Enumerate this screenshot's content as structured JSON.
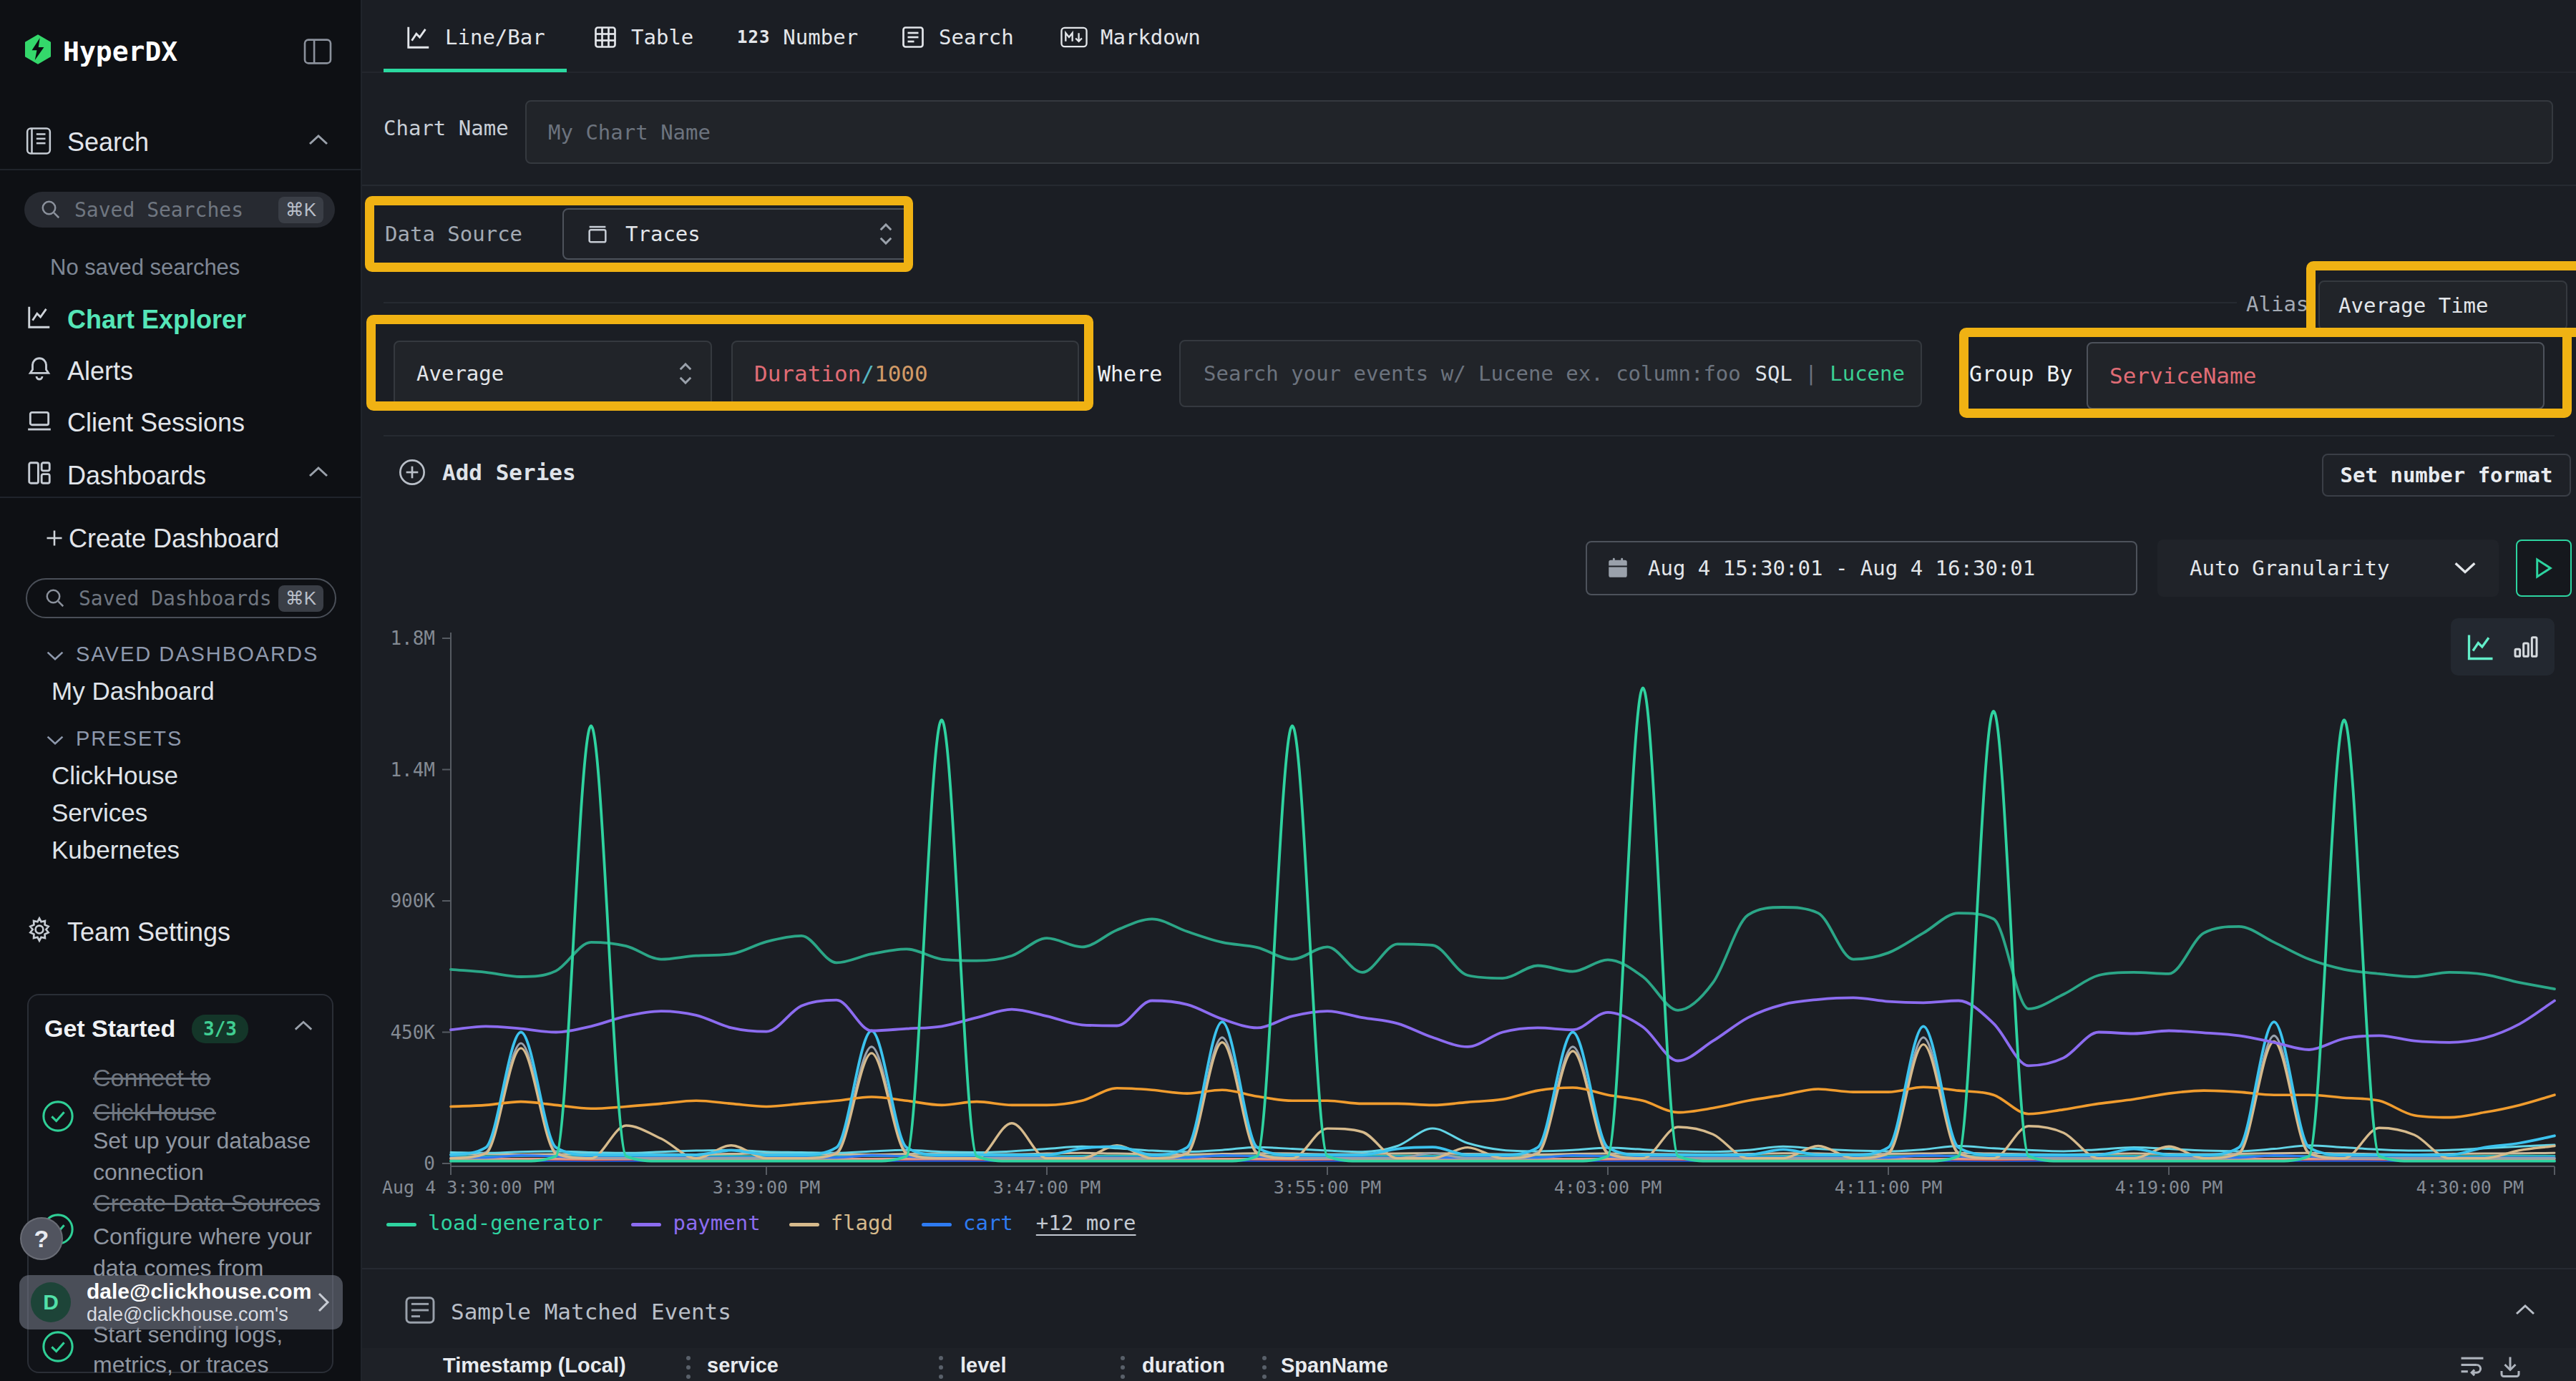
{
  "app": {
    "name": "HyperDX"
  },
  "colors": {
    "sidebar_bg": "#0e1014",
    "main_bg": "#1b1e24",
    "accent_green": "#3fe0ad",
    "annotation_yellow": "#f0b213",
    "input_bg": "#212429",
    "border": "#34383f",
    "border_bright": "#4d525b",
    "text": "#e3e6ea",
    "muted": "#9aa1ab",
    "token_red": "#e06c75",
    "token_cyan": "#56b6c2",
    "token_orange": "#d19a66"
  },
  "sidebar": {
    "logo": "HyperDX",
    "sections": {
      "search": {
        "label": "Search"
      },
      "dashboards": {
        "label": "Dashboards"
      }
    },
    "search_input": {
      "placeholder": "Saved Searches",
      "shortcut": "⌘K"
    },
    "no_saved_searches": "No saved searches",
    "nav": [
      {
        "label": "Chart Explorer",
        "active": true
      },
      {
        "label": "Alerts",
        "active": false
      },
      {
        "label": "Client Sessions",
        "active": false
      }
    ],
    "create_dashboard": "Create Dashboard",
    "dashboards_input": {
      "placeholder": "Saved Dashboards",
      "shortcut": "⌘K"
    },
    "saved_dashboards_label": "SAVED DASHBOARDS",
    "my_dashboard": "My Dashboard",
    "presets_label": "PRESETS",
    "presets": [
      "ClickHouse",
      "Services",
      "Kubernetes"
    ],
    "team_settings": "Team Settings",
    "get_started": {
      "title": "Get Started",
      "badge": "3/3",
      "items": [
        {
          "title_line1": "Connect to",
          "title_line2": "ClickHouse",
          "sub_line1": "Set up your database",
          "sub_line2": "connection",
          "done": true
        },
        {
          "title_line1": "Create Data Sources",
          "title_line2": "",
          "sub_line1": "Configure where your",
          "sub_line2": "data comes from",
          "done": true
        },
        {
          "title_line1": "",
          "title_line2": "",
          "sub_line1": "Start sending logs,",
          "sub_line2": "metrics, or traces",
          "done": true
        }
      ]
    },
    "user": {
      "initial": "D",
      "name": "dale@clickhouse.com",
      "subtext": "dale@clickhouse.com's"
    },
    "help_button": "?"
  },
  "tabs": [
    {
      "label": "Line/Bar",
      "icon": "line-chart",
      "active": true
    },
    {
      "label": "Table",
      "icon": "table",
      "active": false
    },
    {
      "label": "Number",
      "icon": "123",
      "active": false
    },
    {
      "label": "Search",
      "icon": "doc-list",
      "active": false
    },
    {
      "label": "Markdown",
      "icon": "markdown",
      "active": false
    }
  ],
  "chart_form": {
    "chart_name_label": "Chart Name",
    "chart_name_placeholder": "My Chart Name",
    "data_source_label": "Data Source",
    "data_source_value": "Traces",
    "alias_label": "Alias",
    "alias_value": "Average Time",
    "aggregation_value": "Average",
    "field_tokens": {
      "field": "Duration",
      "slash": "/",
      "denominator": "1000"
    },
    "where_label": "Where",
    "where_placeholder": "Search your events w/ Lucene ex. column:foo",
    "language_toggle": {
      "sql": "SQL",
      "divider": "|",
      "lucene": "Lucene"
    },
    "group_by_label": "Group By",
    "group_by_value": "ServiceName",
    "add_series": "Add Series",
    "set_number_format": "Set number format"
  },
  "chart_controls": {
    "date_range": "Aug 4 15:30:01 - Aug 4 16:30:01",
    "granularity": "Auto Granularity"
  },
  "sample_events": {
    "title": "Sample Matched Events",
    "columns": [
      "Timestamp (Local)",
      "service",
      "level",
      "duration",
      "SpanName"
    ]
  },
  "chart_data": {
    "type": "line",
    "title": "",
    "xlabel": "",
    "ylabel": "",
    "x_unit": "minutes after 3:30:00 PM, Aug 4",
    "x_range_minutes": 60,
    "y_unit": "thousands",
    "ylim": [
      0,
      1800
    ],
    "grid": false,
    "legend_position": "bottom-left",
    "x_ticks": [
      {
        "t": 0,
        "label": "Aug 4 3:30:00 PM",
        "align": "left"
      },
      {
        "t": 9,
        "label": "3:39:00 PM",
        "align": "center"
      },
      {
        "t": 17,
        "label": "3:47:00 PM",
        "align": "center"
      },
      {
        "t": 25,
        "label": "3:55:00 PM",
        "align": "center"
      },
      {
        "t": 33,
        "label": "4:03:00 PM",
        "align": "center"
      },
      {
        "t": 41,
        "label": "4:11:00 PM",
        "align": "center"
      },
      {
        "t": 49,
        "label": "4:19:00 PM",
        "align": "center"
      },
      {
        "t": 60,
        "label": "4:30:00 PM",
        "align": "right"
      }
    ],
    "y_ticks": [
      {
        "v": 0,
        "label": "0"
      },
      {
        "v": 450,
        "label": "450K"
      },
      {
        "v": 900,
        "label": "900K"
      },
      {
        "v": 1350,
        "label": "1.4M"
      },
      {
        "v": 1800,
        "label": "1.8M"
      }
    ],
    "legend": {
      "items": [
        {
          "label": "load-generator",
          "series": "load-generator"
        },
        {
          "label": "payment",
          "series": "payment"
        },
        {
          "label": "flagd",
          "series": "flagd"
        },
        {
          "label": "cart",
          "series": "cart"
        }
      ],
      "more_label": "+12 more"
    },
    "series": [
      {
        "name": "unnamed-blue",
        "color": "#2456d9",
        "width": 3.0,
        "values": [
          9,
          9,
          9,
          9,
          9,
          9,
          9,
          9,
          9,
          9,
          9,
          9,
          9,
          9,
          9,
          9,
          9,
          9,
          9,
          9,
          9,
          9,
          9,
          9,
          9,
          9,
          9,
          9,
          9,
          9,
          9,
          9,
          9,
          9,
          9,
          9,
          9,
          9,
          9,
          9,
          9,
          9,
          9,
          9,
          9,
          9,
          9,
          9,
          9,
          9,
          9,
          9,
          9,
          9,
          9,
          9,
          9,
          9,
          9,
          9,
          9
        ]
      },
      {
        "name": "unnamed-orangered",
        "color": "#e8582e",
        "width": 3.0,
        "values": [
          14,
          14,
          15,
          14,
          13,
          14,
          15,
          14,
          13,
          14,
          15,
          14,
          13,
          14,
          15,
          14,
          13,
          14,
          15,
          14,
          13,
          14,
          15,
          14,
          13,
          14,
          15,
          14,
          13,
          14,
          15,
          14,
          13,
          14,
          15,
          14,
          13,
          14,
          15,
          14,
          13,
          14,
          15,
          14,
          13,
          14,
          15,
          14,
          13,
          14,
          15,
          14,
          13,
          14,
          15,
          14,
          13,
          14,
          15,
          14,
          13
        ]
      },
      {
        "name": "unnamed-salmon",
        "color": "#e09a88",
        "width": 3.0,
        "values": [
          16,
          16,
          16,
          16,
          16,
          16,
          16,
          16,
          16,
          16,
          16,
          16,
          16,
          16,
          16,
          16,
          16,
          16,
          16,
          16,
          16,
          16,
          16,
          16,
          16,
          16,
          16,
          16,
          16,
          16,
          16,
          16,
          16,
          16,
          16,
          16,
          16,
          16,
          16,
          16,
          16,
          16,
          16,
          16,
          16,
          16,
          16,
          16,
          16,
          16,
          16,
          16,
          16,
          16,
          16,
          16,
          16,
          16,
          16,
          16,
          16
        ]
      },
      {
        "name": "unnamed-darkcyan",
        "color": "#2fb5b5",
        "width": 3.0,
        "values": [
          26,
          25,
          26,
          27,
          26,
          25,
          26,
          27,
          26,
          25,
          26,
          27,
          26,
          25,
          26,
          27,
          26,
          25,
          26,
          27,
          26,
          25,
          26,
          27,
          26,
          25,
          26,
          27,
          26,
          25,
          26,
          27,
          26,
          25,
          26,
          27,
          26,
          25,
          26,
          27,
          26,
          25,
          26,
          27,
          26,
          25,
          26,
          27,
          26,
          25,
          26,
          27,
          26,
          25,
          26,
          27,
          26,
          25,
          26,
          27,
          26
        ]
      },
      {
        "name": "unnamed-tan-flat",
        "color": "#cdbb9b",
        "width": 3.0,
        "values": [
          32,
          33,
          31,
          32,
          34,
          33,
          32,
          31,
          33,
          35,
          34,
          32,
          31,
          33,
          34,
          33,
          32,
          34,
          36,
          34,
          32,
          31,
          33,
          35,
          34,
          32,
          33,
          34,
          35,
          33,
          32,
          31,
          33,
          34,
          33,
          32,
          31,
          33,
          35,
          34,
          32,
          33,
          34,
          36,
          34,
          32,
          31,
          33,
          34,
          33,
          32,
          33,
          35,
          36,
          34,
          32,
          31,
          33,
          34,
          35,
          36
        ]
      },
      {
        "name": "unnamed-lightcyan",
        "color": "#62d4e6",
        "width": 3.0,
        "values": [
          38,
          36,
          40,
          42,
          38,
          36,
          40,
          44,
          46,
          40,
          38,
          36,
          42,
          46,
          40,
          38,
          42,
          50,
          58,
          52,
          44,
          40,
          46,
          56,
          50,
          44,
          40,
          60,
          120,
          70,
          46,
          42,
          46,
          54,
          48,
          42,
          40,
          46,
          58,
          50,
          44,
          42,
          48,
          60,
          52,
          46,
          42,
          48,
          55,
          50,
          44,
          42,
          50,
          62,
          55,
          48,
          44,
          46,
          52,
          58,
          64
        ]
      },
      {
        "name": "cart",
        "color": "#2e7bf2",
        "width": 3.2,
        "values": [
          20,
          20,
          28,
          24,
          20,
          20,
          20,
          20,
          20,
          20,
          20,
          20,
          28,
          24,
          20,
          20,
          20,
          20,
          20,
          20,
          20,
          20,
          28,
          24,
          20,
          20,
          20,
          20,
          20,
          20,
          20,
          20,
          28,
          24,
          20,
          20,
          20,
          20,
          20,
          20,
          20,
          20,
          28,
          24,
          20,
          20,
          20,
          20,
          20,
          20,
          20,
          20,
          28,
          24,
          20,
          20,
          20,
          20,
          20,
          20,
          20
        ]
      },
      {
        "name": "unnamed-gray",
        "color": "#97a1ad",
        "width": 3.2,
        "values": [
          18,
          38,
          412,
          38,
          18,
          18,
          18,
          18,
          18,
          18,
          18,
          38,
          400,
          38,
          18,
          18,
          18,
          18,
          18,
          18,
          18,
          38,
          432,
          38,
          18,
          18,
          18,
          18,
          35,
          18,
          18,
          38,
          400,
          38,
          18,
          18,
          18,
          18,
          18,
          18,
          18,
          38,
          432,
          38,
          18,
          18,
          18,
          18,
          18,
          18,
          18,
          38,
          438,
          38,
          18,
          18,
          18,
          18,
          18,
          18,
          18
        ]
      },
      {
        "name": "flagd",
        "color": "#d6ba8c",
        "width": 3.4,
        "values": [
          18,
          34,
          395,
          34,
          18,
          130,
          85,
          18,
          62,
          18,
          18,
          34,
          378,
          34,
          18,
          18,
          138,
          18,
          18,
          62,
          18,
          34,
          415,
          34,
          18,
          120,
          108,
          18,
          18,
          55,
          18,
          34,
          385,
          34,
          18,
          125,
          100,
          18,
          18,
          60,
          18,
          34,
          408,
          34,
          18,
          128,
          105,
          18,
          18,
          58,
          18,
          34,
          418,
          34,
          18,
          122,
          98,
          18,
          18,
          45,
          60
        ]
      },
      {
        "name": "unnamed-orange",
        "color": "#f09c2e",
        "width": 3.6,
        "values": [
          195,
          200,
          212,
          200,
          188,
          195,
          205,
          215,
          205,
          195,
          205,
          215,
          228,
          215,
          200,
          212,
          200,
          200,
          215,
          258,
          252,
          240,
          252,
          230,
          215,
          215,
          205,
          205,
          200,
          210,
          220,
          250,
          260,
          235,
          215,
          175,
          190,
          215,
          235,
          255,
          245,
          245,
          262,
          250,
          235,
          170,
          185,
          205,
          220,
          240,
          250,
          245,
          235,
          235,
          225,
          215,
          165,
          158,
          175,
          200,
          235
        ]
      },
      {
        "name": "unnamed-cyan",
        "color": "#3cc3ee",
        "width": 3.8,
        "values": [
          30,
          55,
          450,
          55,
          30,
          30,
          30,
          30,
          45,
          30,
          30,
          55,
          455,
          55,
          30,
          30,
          30,
          30,
          52,
          58,
          30,
          55,
          485,
          55,
          30,
          30,
          30,
          50,
          56,
          30,
          30,
          55,
          450,
          55,
          30,
          30,
          30,
          30,
          48,
          30,
          30,
          55,
          470,
          55,
          30,
          30,
          30,
          30,
          50,
          30,
          30,
          55,
          485,
          55,
          30,
          30,
          30,
          30,
          55,
          70,
          95
        ]
      },
      {
        "name": "unnamed-teal",
        "color": "#2ba687",
        "width": 3.8,
        "values": [
          665,
          655,
          640,
          660,
          758,
          745,
          700,
          712,
          718,
          760,
          780,
          688,
          718,
          735,
          700,
          695,
          712,
          772,
          742,
          800,
          838,
          795,
          758,
          740,
          700,
          742,
          655,
          752,
          748,
          645,
          635,
          678,
          658,
          698,
          640,
          525,
          620,
          852,
          878,
          858,
          700,
          722,
          790,
          858,
          838,
          530,
          580,
          645,
          655,
          650,
          790,
          812,
          758,
          700,
          665,
          650,
          640,
          655,
          648,
          620,
          598
        ]
      },
      {
        "name": "payment",
        "color": "#8c6cf0",
        "width": 3.8,
        "values": [
          458,
          470,
          462,
          450,
          470,
          505,
          522,
          508,
          465,
          452,
          540,
          560,
          455,
          462,
          470,
          500,
          528,
          505,
          475,
          472,
          558,
          545,
          495,
          465,
          505,
          522,
          500,
          480,
          432,
          400,
          450,
          465,
          458,
          518,
          468,
          352,
          420,
          500,
          545,
          562,
          568,
          555,
          551,
          558,
          480,
          335,
          362,
          450,
          445,
          455,
          448,
          438,
          415,
          390,
          428,
          438,
          420,
          415,
          430,
          478,
          558
        ]
      },
      {
        "name": "load-generator",
        "color": "#2fd3a0",
        "width": 3.8,
        "values": [
          8,
          8,
          8,
          25,
          1500,
          25,
          8,
          8,
          8,
          8,
          8,
          8,
          8,
          25,
          1520,
          25,
          8,
          8,
          8,
          8,
          8,
          8,
          8,
          25,
          1500,
          25,
          8,
          8,
          8,
          8,
          8,
          8,
          8,
          25,
          1630,
          25,
          8,
          8,
          8,
          8,
          8,
          8,
          8,
          25,
          1550,
          25,
          8,
          8,
          8,
          8,
          8,
          8,
          8,
          25,
          1520,
          25,
          8,
          8,
          8,
          8,
          8
        ]
      }
    ]
  }
}
